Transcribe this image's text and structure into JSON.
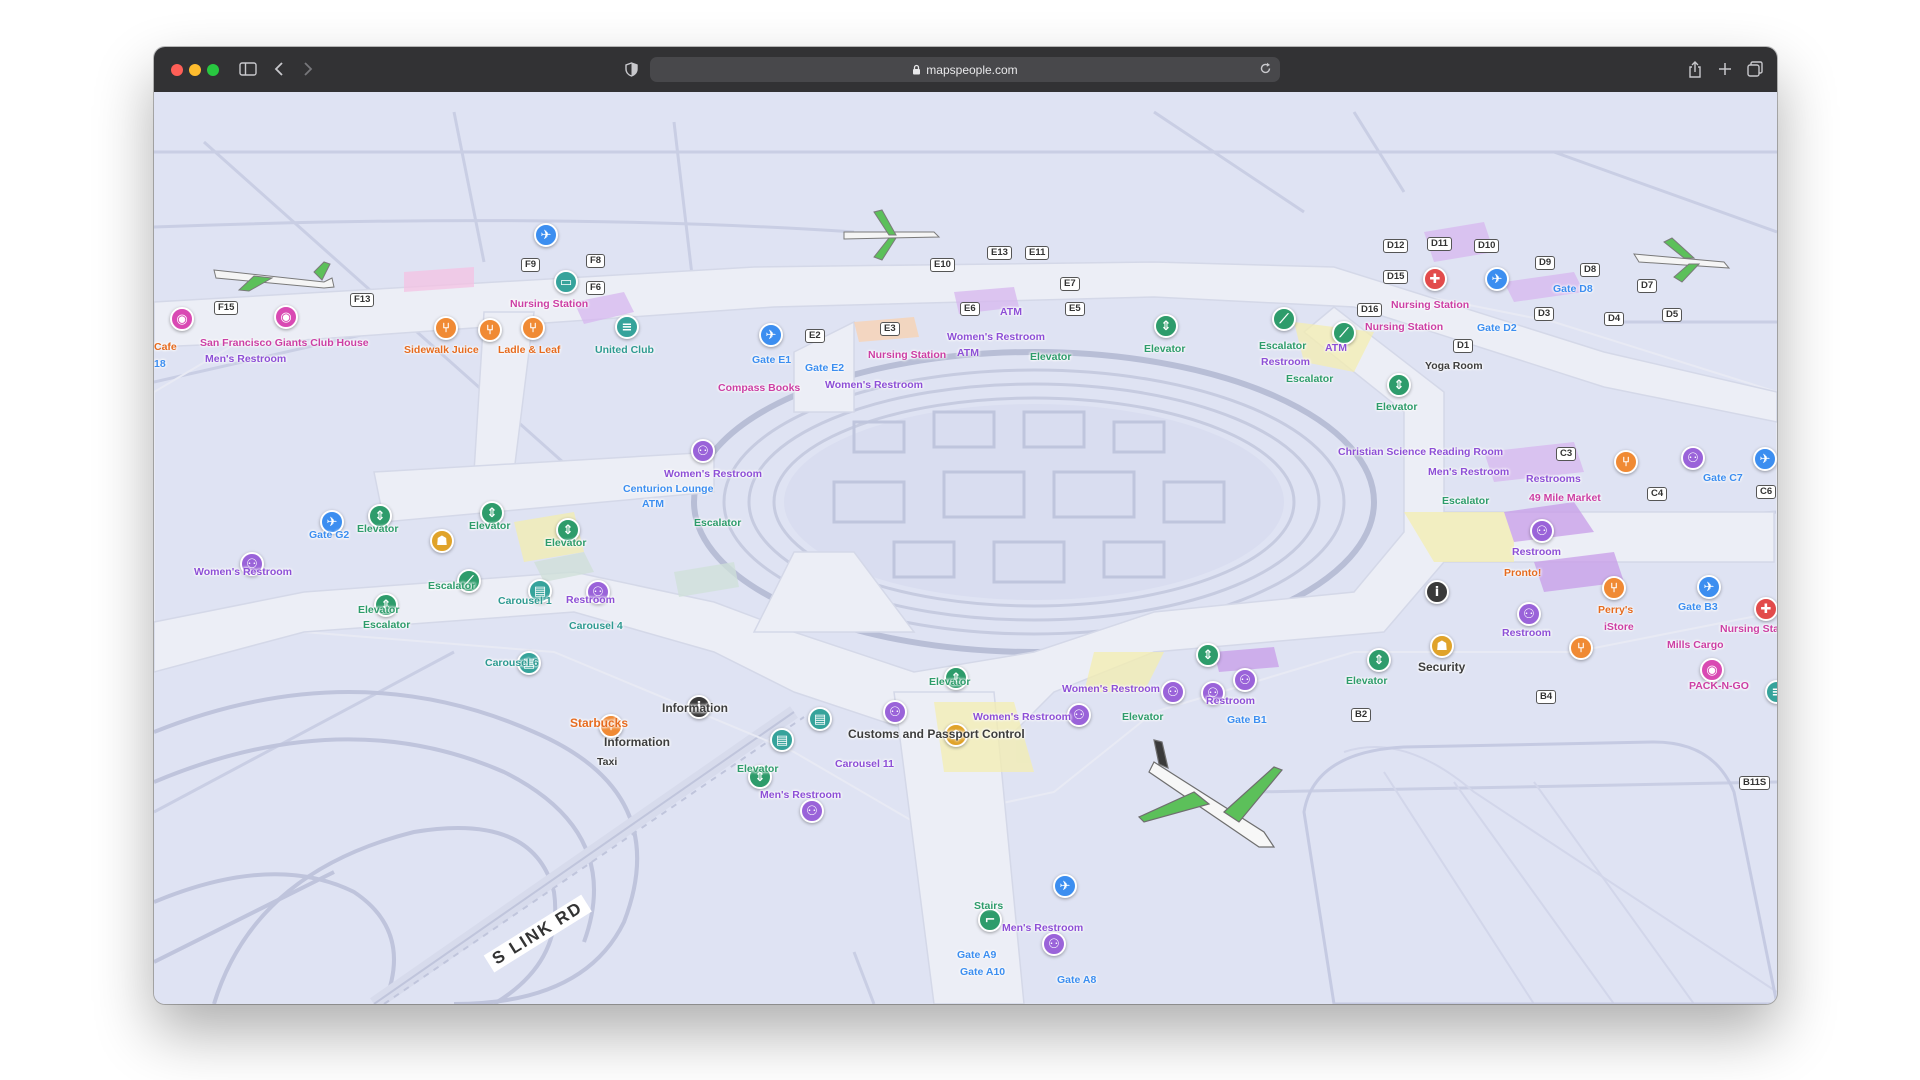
{
  "browser": {
    "url": "mapspeople.com",
    "colors": {
      "close": "#ff5f57",
      "minimize": "#febc2e",
      "zoom": "#28c840"
    },
    "icons": [
      "sidebar-icon",
      "back-icon",
      "forward-icon",
      "shield-icon",
      "lock-icon",
      "reload-icon",
      "share-icon",
      "new-tab-icon",
      "tabs-overview-icon"
    ]
  },
  "map": {
    "road_label": "S LINK RD",
    "gates": {
      "f15": "F15",
      "f13": "F13",
      "f9": "F9",
      "f8": "F8",
      "f6": "F6",
      "e13": "E13",
      "e11": "E11",
      "e10": "E10",
      "e7": "E7",
      "e6": "E6",
      "e5": "E5",
      "e3": "E3",
      "e2": "E2",
      "d12": "D12",
      "d11": "D11",
      "d10": "D10",
      "d9": "D9",
      "d8": "D8",
      "d7": "D7",
      "d15": "D15",
      "d16": "D16",
      "d5": "D5",
      "d4": "D4",
      "d3": "D3",
      "d1": "D1",
      "c3": "C3",
      "c4": "C4",
      "c6": "C6",
      "b2": "B2",
      "b4": "B4",
      "b11s": "B11S"
    },
    "labels": {
      "cafe": "Cafe",
      "cafe_num": "18",
      "sf_giants": "San Francisco Giants Club House",
      "mens_restroom_f": "Men's Restroom",
      "sidewalk_juice": "Sidewalk Juice",
      "ladle_leaf": "Ladle & Leaf",
      "nursing_station_f": "Nursing Station",
      "united_club": "United Club",
      "gate_e1": "Gate E1",
      "gate_e2": "Gate E2",
      "nursing_station_e": "Nursing Station",
      "atm_e": "ATM",
      "womens_restroom_e1": "Women's Restroom",
      "womens_restroom_e2": "Women's Restroom",
      "atm_e2": "ATM",
      "elevator_e": "Elevator",
      "compass_books": "Compass Books",
      "elevator_e2": "Elevator",
      "escalator_d1": "Escalator",
      "restroom_d": "Restroom",
      "escalator_d2": "Escalator",
      "atm_d": "ATM",
      "nursing_station_d1": "Nursing Station",
      "nursing_station_d2": "Nursing Station",
      "gate_d8": "Gate D8",
      "gate_d2": "Gate D2",
      "yoga_room": "Yoga Room",
      "elevator_d": "Elevator",
      "christian_science": "Christian Science Reading Room",
      "mens_restroom_c": "Men's Restroom",
      "restrooms_c": "Restrooms",
      "escalator_c": "Escalator",
      "mile_market": "49 Mile Market",
      "gate_c7": "Gate C7",
      "restroom_c": "Restroom",
      "pronto": "Pronto!",
      "perrys": "Perry's",
      "istore": "iStore",
      "gate_b3": "Gate B3",
      "nursing_sta": "Nursing Sta",
      "mills_cargo": "Mills Cargo",
      "restroom_b": "Restroom",
      "pack_n_go": "PACK-N-GO",
      "security": "Security",
      "elevator_b": "Elevator",
      "restroom_b1": "Restroom",
      "gate_b1": "Gate B1",
      "womens_restroom_cen": "Women's Restroom",
      "centurion": "Centurion Lounge",
      "atm_cen": "ATM",
      "escalator_cen": "Escalator",
      "gate_g2": "Gate G2",
      "elevator_g1": "Elevator",
      "elevator_g2": "Elevator",
      "elevator_g3": "Elevator",
      "womens_restroom_g": "Women's Restroom",
      "escalator_g": "Escalator",
      "elevator_g4": "Elevator",
      "escalator_g2": "Escalator",
      "carousel_1": "Carousel 1",
      "restroom_g": "Restroom",
      "carousel_4": "Carousel 4",
      "carousel_6": "Carousel 6",
      "information_1": "Information",
      "starbucks": "Starbucks",
      "information_2": "Information",
      "taxi": "Taxi",
      "elevator_a1": "Elevator",
      "customs": "Customs and Passport Control",
      "womens_restroom_a1": "Women's Restroom",
      "womens_restroom_a2": "Women's Restroom",
      "elevator_a2": "Elevator",
      "elevator_a3": "Elevator",
      "carousel_11": "Carousel 11",
      "mens_restroom_a": "Men's Restroom",
      "stairs": "Stairs",
      "mens_restroom_a2": "Men's Restroom",
      "gate_a9": "Gate A9",
      "gate_a10": "Gate A10",
      "gate_a8": "Gate A8"
    }
  }
}
